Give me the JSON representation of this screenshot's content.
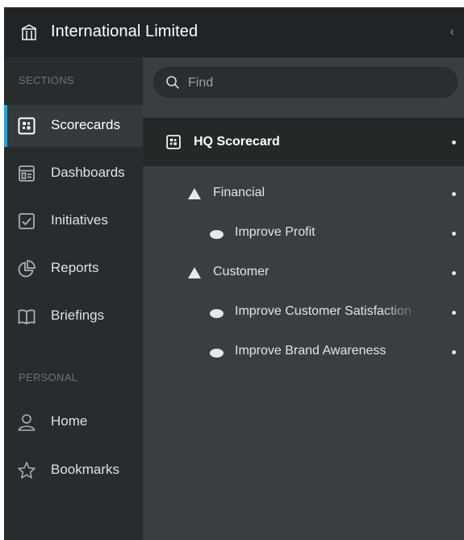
{
  "header": {
    "title": "International Limited",
    "collapse_glyph": "‹",
    "logo_icon": "building-icon"
  },
  "sidebar": {
    "sections_label": "SECTIONS",
    "sections": [
      {
        "label": "Scorecards",
        "icon": "scorecard-icon",
        "active": true
      },
      {
        "label": "Dashboards",
        "icon": "dashboard-icon",
        "active": false
      },
      {
        "label": "Initiatives",
        "icon": "checkbox-icon",
        "active": false
      },
      {
        "label": "Reports",
        "icon": "pie-chart-icon",
        "active": false
      },
      {
        "label": "Briefings",
        "icon": "book-icon",
        "active": false
      }
    ],
    "personal_label": "PERSONAL",
    "personal": [
      {
        "label": "Home",
        "icon": "user-icon"
      },
      {
        "label": "Bookmarks",
        "icon": "star-icon"
      }
    ]
  },
  "main": {
    "search": {
      "placeholder": "Find",
      "value": ""
    },
    "tree": {
      "root": {
        "label": "HQ Scorecard",
        "icon": "scorecard-icon"
      },
      "items": [
        {
          "label": "Financial",
          "kind": "perspective"
        },
        {
          "label": "Improve Profit",
          "kind": "objective"
        },
        {
          "label": "Customer",
          "kind": "perspective"
        },
        {
          "label": "Improve Customer Satisfaction",
          "kind": "objective"
        },
        {
          "label": "Improve Brand Awareness",
          "kind": "objective"
        }
      ]
    }
  },
  "colors": {
    "accent": "#2e9fd8",
    "header_bg": "#212426",
    "sidebar_bg": "#282c2e",
    "main_bg": "#3a3e40",
    "selected_row_bg": "#252829"
  }
}
